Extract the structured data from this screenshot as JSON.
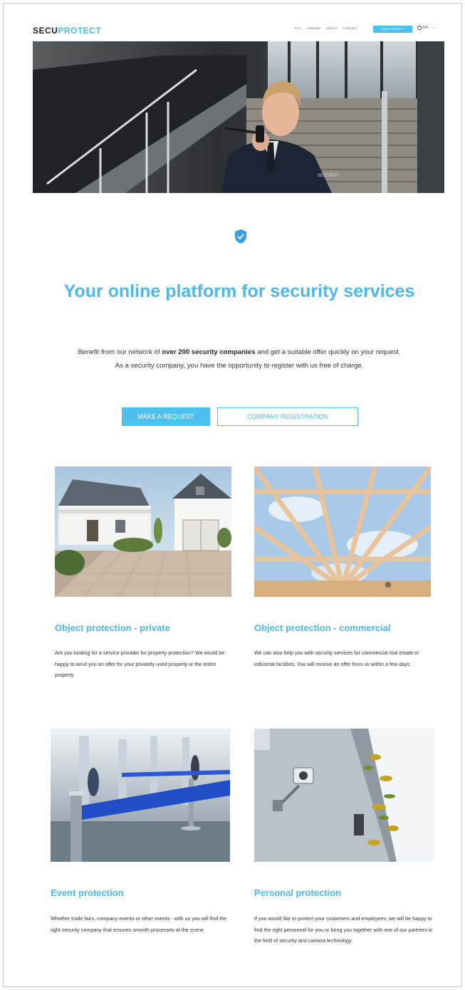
{
  "header": {
    "logo_part1": "SECU",
    "logo_part2": "PROTECT",
    "nav": [
      "EVS",
      "COMPANY",
      "SAFETY",
      "CONTACT"
    ],
    "cta_label": "MAKE A REQUEST",
    "language": "EN"
  },
  "hero": {
    "badge_text": "SECURITY"
  },
  "main": {
    "headline": "Your online platform for security services",
    "intro_part1": "Benefit from our network of ",
    "intro_bold": "over 200 security companies",
    "intro_part2": " and get a suitable offer quickly on your request. As a security company, you have the opportunity to register with us free of charge.",
    "primary_button": "MAKE A REQUEST",
    "secondary_button": "COMPANY REGISTRATION"
  },
  "services": [
    {
      "title": "Object protection - private",
      "text": "Are you looking for a service provider for property protection? We would be happy to send you an offer for your privately used property or the entire property."
    },
    {
      "title": "Object protection - commercial",
      "text": "We can also help you with security services for commercial real estate or industrial facilities. You will receive an offer from us within a few days."
    },
    {
      "title": "Event protection",
      "text": "Whether trade fairs, company events or other events - with us you will find the right security company that ensures smooth processes at the scene."
    },
    {
      "title": "Personal protection",
      "text": "If you would like to protect your customers and employees, we will be happy to find the right personnel for you or bring you together with one of our partners in the field of security and camera technology."
    }
  ],
  "colors": {
    "accent": "#4fb8e6",
    "button": "#4fc0ee",
    "shield": "#3aa0dc"
  }
}
